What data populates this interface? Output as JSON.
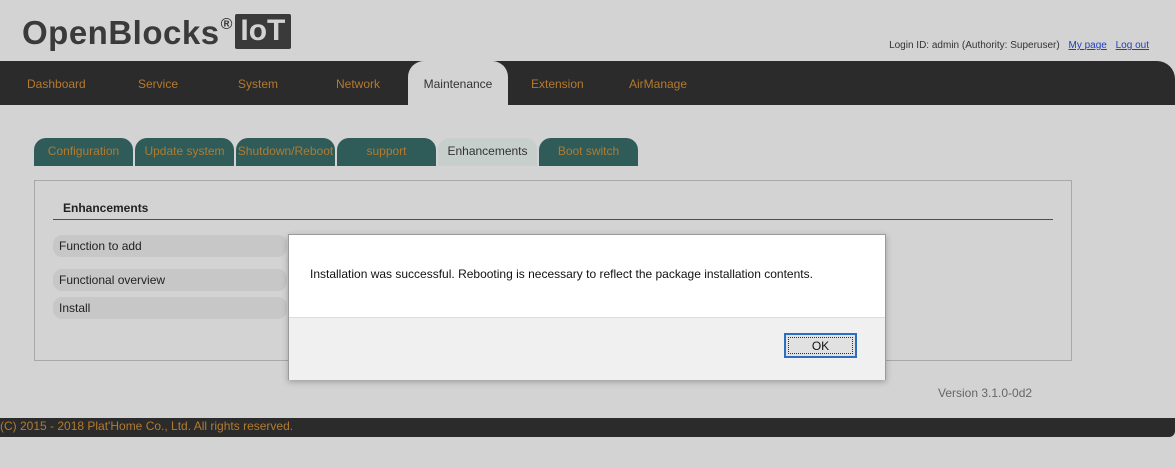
{
  "header": {
    "logo_text": "OpenBlocks",
    "logo_reg": "®",
    "logo_suffix": "IoT",
    "login_info": "Login ID: admin (Authority: Superuser)",
    "my_page_link": "My page",
    "logout_link": "Log out"
  },
  "main_nav": {
    "items": [
      "Dashboard",
      "Service",
      "System",
      "Network",
      "Maintenance",
      "Extension",
      "AirManage"
    ],
    "active": "Maintenance"
  },
  "sub_tabs": {
    "items": [
      "Configuration",
      "Update system",
      "Shutdown/Reboot",
      "support",
      "Enhancements",
      "Boot switch"
    ],
    "active": "Enhancements"
  },
  "panel": {
    "title": "Enhancements",
    "rows": [
      "Function to add",
      "Functional overview",
      "Install"
    ]
  },
  "version": "Version 3.1.0-0d2",
  "footer": {
    "copyright": "(C) 2015 - 2018 Plat'Home Co., Ltd. All rights reserved."
  },
  "dialog": {
    "message": "Installation was successful. Rebooting is necessary to reflect the package installation contents.",
    "ok_label": "OK"
  },
  "colors": {
    "nav_bg": "#2b2b2b",
    "nav_text": "#b37a2f",
    "tab_bg": "#2f5b59",
    "page_bg": "#d3d3d3",
    "link": "#1f3fbf",
    "button_focus": "#2d6ec2"
  }
}
